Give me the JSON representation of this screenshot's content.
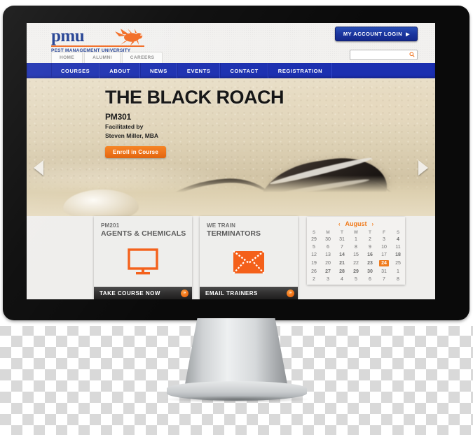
{
  "device": {
    "type": "desktop-monitor"
  },
  "site": {
    "header": {
      "logo_text": "pmu",
      "logo_subtitle": "PEST MANAGEMENT UNIVERSITY",
      "logo_icon": "roach-icon",
      "login_label": "MY ACCOUNT LOGIN",
      "login_caret": "▶",
      "search_placeholder": "",
      "search_value": "",
      "search_icon": "search-icon"
    },
    "subnav": [
      {
        "label": "HOME"
      },
      {
        "label": "ALUMNI"
      },
      {
        "label": "CAREERS"
      }
    ],
    "mainnav": [
      {
        "label": "COURSES"
      },
      {
        "label": "ABOUT"
      },
      {
        "label": "NEWS"
      },
      {
        "label": "EVENTS"
      },
      {
        "label": "CONTACT"
      },
      {
        "label": "REGISTRATION"
      }
    ],
    "hero": {
      "title": "THE BLACK ROACH",
      "course_code": "PM301",
      "facilitated_line1": "Facilitated by",
      "facilitated_line2": "Steven Miller, MBA",
      "cta_label": "Enroll in Course",
      "prev_icon": "chevron-left-icon",
      "next_icon": "chevron-right-icon"
    },
    "cards": [
      {
        "sup": "PM201",
        "title": "AGENTS & CHEMICALS",
        "icon": "monitor-icon",
        "cta_label": "TAKE COURSE NOW",
        "cta_badge": "»"
      },
      {
        "sup": "WE TRAIN",
        "title": "TERMINATORS",
        "icon": "envelope-icon",
        "cta_label": "EMAIL TRAINERS",
        "cta_badge": "»"
      }
    ],
    "calendar": {
      "month": "August",
      "prev_icon": "‹",
      "next_icon": "›",
      "day_headers": [
        "S",
        "M",
        "T",
        "W",
        "T",
        "F",
        "S"
      ],
      "selected_day": 24,
      "weeks": [
        [
          {
            "d": "29",
            "s": "mute"
          },
          {
            "d": "30",
            "s": "mute"
          },
          {
            "d": "31",
            "s": "mute"
          },
          {
            "d": "1",
            "s": ""
          },
          {
            "d": "2",
            "s": ""
          },
          {
            "d": "3",
            "s": ""
          },
          {
            "d": "4",
            "s": "ev"
          }
        ],
        [
          {
            "d": "5",
            "s": ""
          },
          {
            "d": "6",
            "s": ""
          },
          {
            "d": "7",
            "s": ""
          },
          {
            "d": "8",
            "s": ""
          },
          {
            "d": "9",
            "s": ""
          },
          {
            "d": "10",
            "s": ""
          },
          {
            "d": "11",
            "s": ""
          }
        ],
        [
          {
            "d": "12",
            "s": ""
          },
          {
            "d": "13",
            "s": ""
          },
          {
            "d": "14",
            "s": "ev"
          },
          {
            "d": "15",
            "s": ""
          },
          {
            "d": "16",
            "s": "ev"
          },
          {
            "d": "17",
            "s": ""
          },
          {
            "d": "18",
            "s": "ev"
          }
        ],
        [
          {
            "d": "19",
            "s": ""
          },
          {
            "d": "20",
            "s": ""
          },
          {
            "d": "21",
            "s": "ev"
          },
          {
            "d": "22",
            "s": ""
          },
          {
            "d": "23",
            "s": "ev"
          },
          {
            "d": "24",
            "s": "sel"
          },
          {
            "d": "25",
            "s": ""
          }
        ],
        [
          {
            "d": "26",
            "s": ""
          },
          {
            "d": "27",
            "s": "ev"
          },
          {
            "d": "28",
            "s": "ev"
          },
          {
            "d": "29",
            "s": "ev"
          },
          {
            "d": "30",
            "s": "ev"
          },
          {
            "d": "31",
            "s": ""
          },
          {
            "d": "1",
            "s": "mute"
          }
        ],
        [
          {
            "d": "2",
            "s": "mute"
          },
          {
            "d": "3",
            "s": "mute"
          },
          {
            "d": "4",
            "s": "mute"
          },
          {
            "d": "5",
            "s": "mute"
          },
          {
            "d": "6",
            "s": "mute"
          },
          {
            "d": "7",
            "s": "mute"
          },
          {
            "d": "8",
            "s": "mute"
          }
        ]
      ]
    }
  },
  "colors": {
    "brand_blue": "#1b2fb0",
    "logo_blue": "#1b3a8f",
    "accent_orange": "#f07c1e",
    "cta_orange": "#ef7115",
    "dark_bar": "#2b2a2a"
  }
}
